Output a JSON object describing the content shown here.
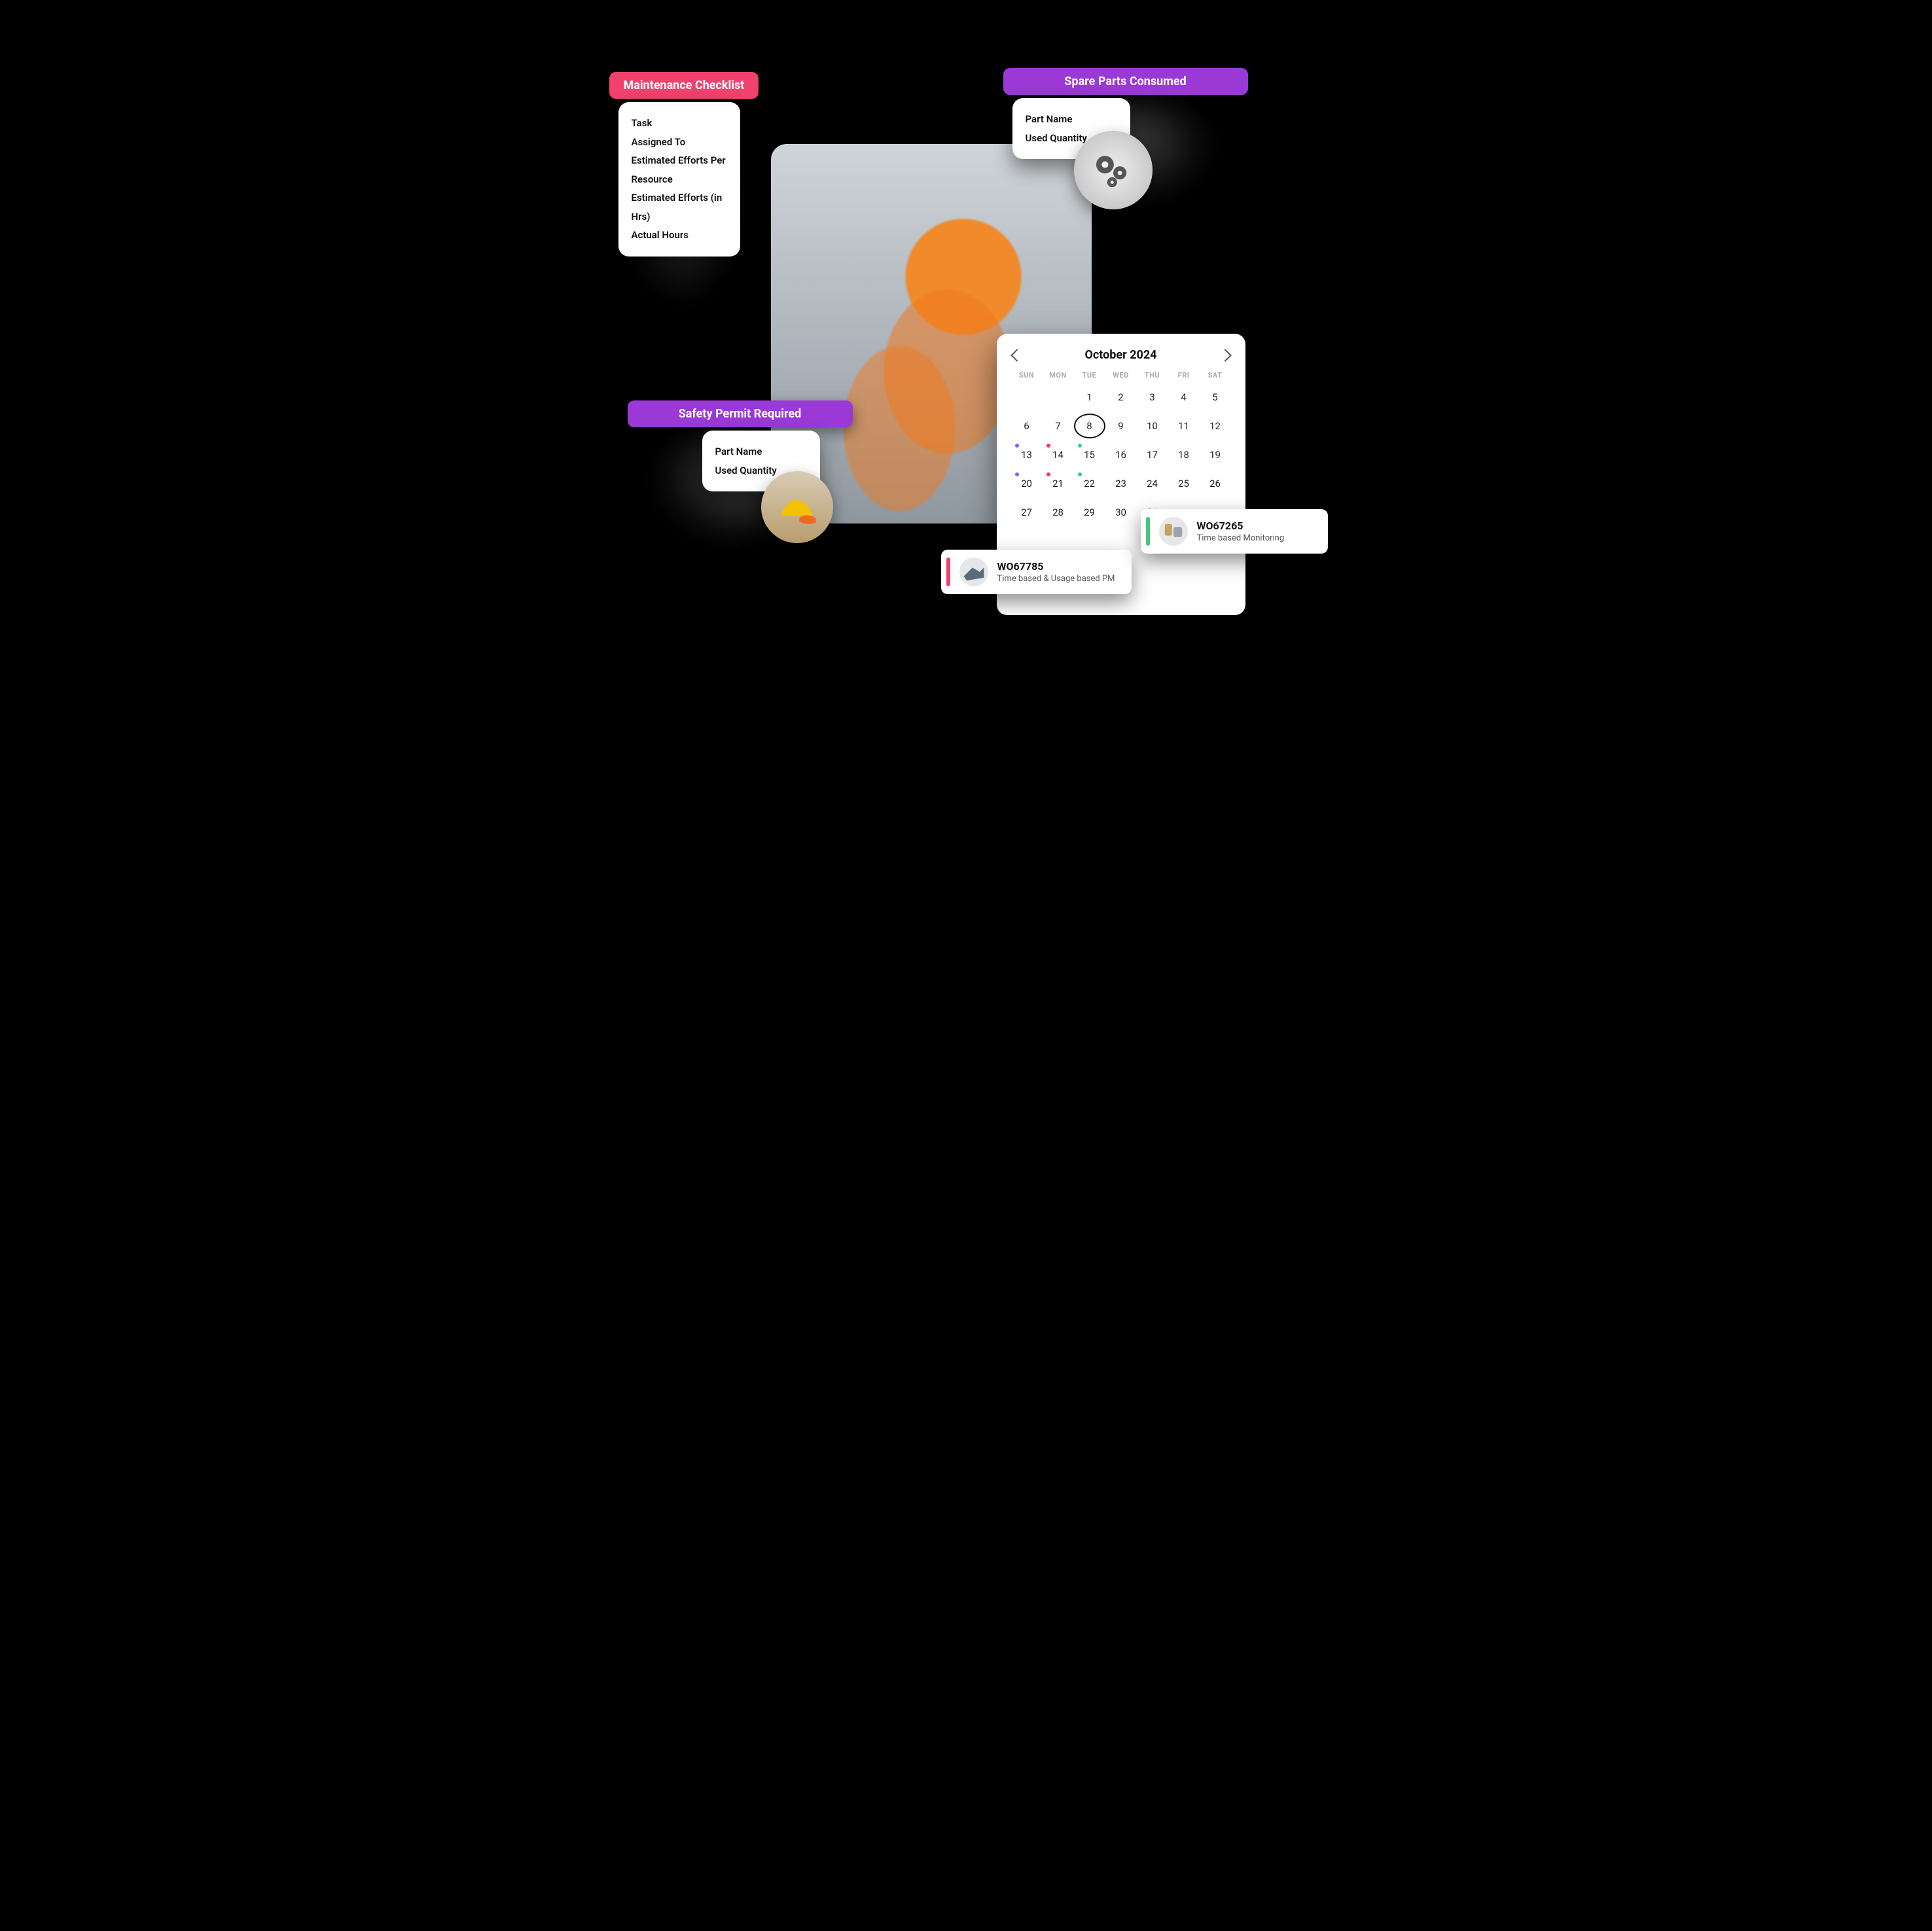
{
  "checklist": {
    "title": "Maintenance Checklist",
    "fields": [
      "Task",
      "Assigned To",
      "Estimated Efforts Per Resource",
      "Estimated Efforts (in Hrs)",
      "Actual Hours"
    ]
  },
  "spare_parts": {
    "title": "Spare Parts Consumed",
    "fields": [
      "Part Name",
      "Used Quantity"
    ]
  },
  "safety_permit": {
    "title": "Safety Permit Required",
    "fields": [
      "Part Name",
      "Used Quantity"
    ]
  },
  "calendar": {
    "title": "October 2024",
    "dow": [
      "SUN",
      "MON",
      "TUE",
      "WED",
      "THU",
      "FRI",
      "SAT"
    ],
    "leading_blanks": 2,
    "selected_day": 8,
    "days": 31,
    "markers": {
      "13": [
        "p"
      ],
      "14": [
        "k"
      ],
      "15": [
        "g"
      ],
      "20": [
        "p"
      ],
      "21": [
        "k"
      ],
      "22": [
        "g"
      ]
    }
  },
  "work_orders": [
    {
      "id": "WO67785",
      "desc": "Time based & Usage based PM",
      "color": "pink"
    },
    {
      "id": "WO67265",
      "desc": "Time based Monitoring",
      "color": "green"
    }
  ]
}
